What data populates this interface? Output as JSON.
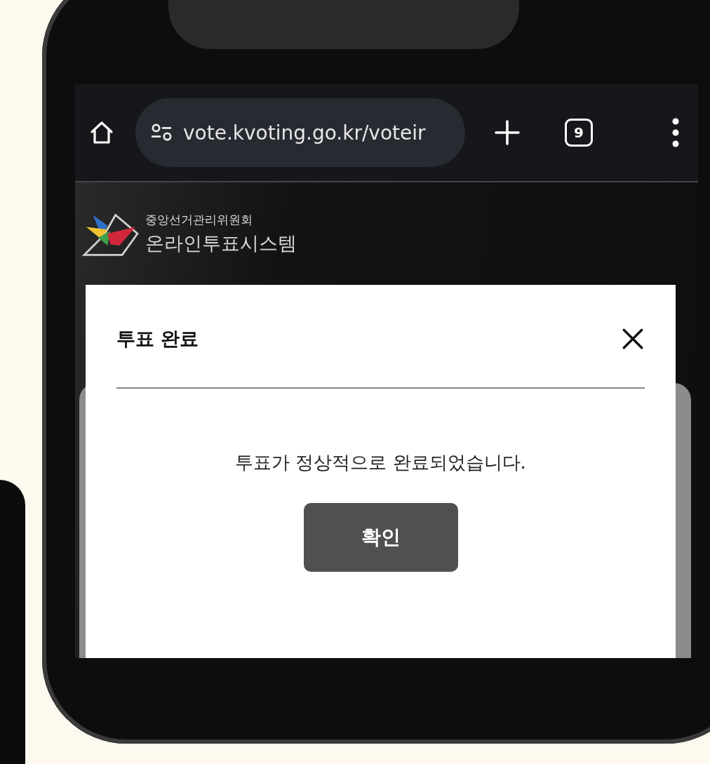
{
  "browser": {
    "url": "vote.kvoting.go.kr/voteir",
    "tab_count": "9"
  },
  "site": {
    "organization": "중앙선거관리위원회",
    "system_name": "온라인투표시스템"
  },
  "dialog": {
    "title": "투표 완료",
    "message": "투표가 정상적으로 완료되었습니다.",
    "buttons": [
      "확인"
    ]
  }
}
